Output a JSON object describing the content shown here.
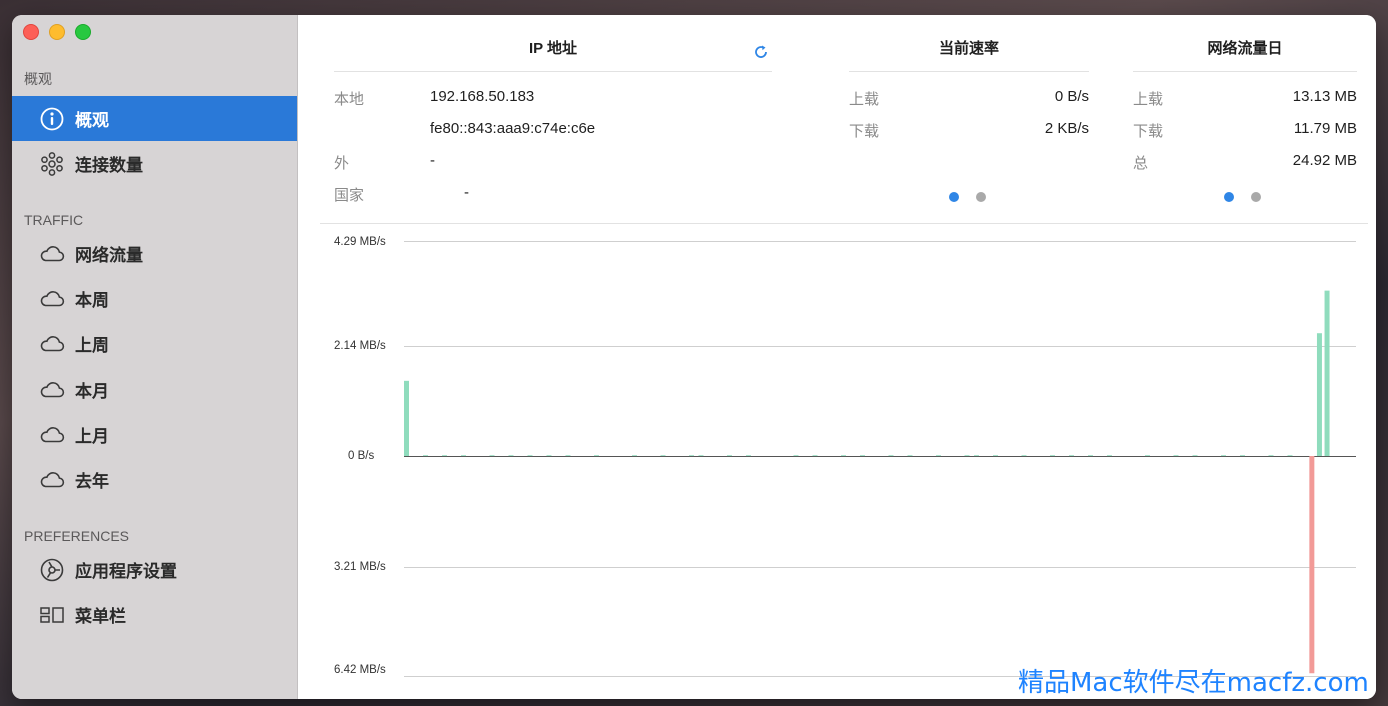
{
  "sidebar": {
    "overview_section": "概观",
    "items_top": [
      {
        "label": "概观",
        "icon": "info-icon",
        "active": true
      },
      {
        "label": "连接数量",
        "icon": "connections-icon",
        "active": false
      }
    ],
    "traffic_section": "TRAFFIC",
    "traffic_items": [
      {
        "label": "网络流量",
        "icon": "cloud-icon"
      },
      {
        "label": "本周",
        "icon": "cloud-icon"
      },
      {
        "label": "上周",
        "icon": "cloud-icon"
      },
      {
        "label": "本月",
        "icon": "cloud-icon"
      },
      {
        "label": "上月",
        "icon": "cloud-icon"
      },
      {
        "label": "去年",
        "icon": "cloud-icon"
      }
    ],
    "preferences_section": "PREFERENCES",
    "preferences_items": [
      {
        "label": "应用程序设置",
        "icon": "settings-icon"
      },
      {
        "label": "菜单栏",
        "icon": "menubar-icon"
      }
    ]
  },
  "ip_panel": {
    "title": "IP 地址",
    "local_label": "本地",
    "local_ipv4": "192.168.50.183",
    "local_ipv6": "fe80::843:aaa9:c74e:c6e",
    "external_label": "外",
    "external_value": "-",
    "country_label": "国家",
    "country_value": "-"
  },
  "speed_panel": {
    "title": "当前速率",
    "upload_label": "上载",
    "upload_value": "0 B/s",
    "download_label": "下载",
    "download_value": "2 KB/s"
  },
  "traffic_panel": {
    "title": "网络流量日",
    "upload_label": "上载",
    "upload_value": "13.13 MB",
    "download_label": "下载",
    "download_value": "11.79 MB",
    "total_label": "总",
    "total_value": "24.92 MB"
  },
  "pager_colors": {
    "active": "#2f86e6",
    "inactive": "#a9a9a9"
  },
  "chart_data": {
    "type": "bar",
    "y_tick_labels_top": [
      "4.29 MB/s",
      "2.14 MB/s",
      "0 B/s"
    ],
    "y_tick_labels_bottom": [
      "3.21 MB/s",
      "6.42 MB/s"
    ],
    "upload_max": 4.29,
    "download_max": 6.42,
    "series": [
      {
        "color": "#8fdcbd",
        "values": [
          {
            "x": 0,
            "y": 1.5
          },
          {
            "x": 0.961,
            "y": 2.45
          },
          {
            "x": 0.969,
            "y": 3.3
          }
        ]
      },
      {
        "color": "#f29a97",
        "values": [
          {
            "x": 0.953,
            "y": 6.34
          }
        ]
      }
    ],
    "small_upload_x": [
      0.02,
      0.04,
      0.06,
      0.09,
      0.11,
      0.13,
      0.15,
      0.17,
      0.2,
      0.24,
      0.27,
      0.3,
      0.31,
      0.34,
      0.36,
      0.41,
      0.43,
      0.46,
      0.48,
      0.51,
      0.53,
      0.56,
      0.59,
      0.6,
      0.62,
      0.65,
      0.68,
      0.7,
      0.72,
      0.74,
      0.78,
      0.81,
      0.83,
      0.86,
      0.88,
      0.91,
      0.93
    ]
  },
  "watermark": "精品Mac软件尽在macfz.com"
}
